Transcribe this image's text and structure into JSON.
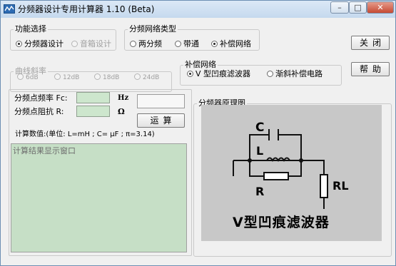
{
  "window": {
    "title": "分频器设计专用计算器 1.10 (Beta)",
    "controls": {
      "minimize": "–",
      "maximize": "□",
      "close": "✕"
    }
  },
  "function_group": {
    "legend": "功能选择",
    "options": [
      {
        "label": "分频器设计",
        "selected": true,
        "enabled": true
      },
      {
        "label": "音箱设计",
        "selected": false,
        "enabled": false
      }
    ]
  },
  "network_type_group": {
    "legend": "分频网络类型",
    "options": [
      {
        "label": "两分频",
        "selected": false
      },
      {
        "label": "带通",
        "selected": false
      },
      {
        "label": "补偿网络",
        "selected": true
      }
    ]
  },
  "slope_group": {
    "legend": "曲线斜率",
    "options": [
      {
        "label": "6dB"
      },
      {
        "label": "12dB"
      },
      {
        "label": "18dB"
      },
      {
        "label": "24dB"
      }
    ]
  },
  "compensation_group": {
    "legend": "补偿网络",
    "options": [
      {
        "label": "V 型凹痕滤波器",
        "selected": true
      },
      {
        "label": "渐斜补偿电路",
        "selected": false
      }
    ]
  },
  "buttons": {
    "close": "关闭",
    "help": "帮助",
    "compute": "运算"
  },
  "inputs": {
    "freq_label": "分频点频率 Fc:",
    "freq_value": "",
    "freq_unit": "Hz",
    "imp_label": "分频点阻抗 R:",
    "imp_value": "",
    "imp_unit": "Ω"
  },
  "calc_info": "计算数值:(单位: L=mH  ; C= μF  ; π=3.14)",
  "result_placeholder": "计算结果显示窗口",
  "diagram": {
    "legend": "分频器原理图",
    "labels": {
      "c": "C",
      "l": "L",
      "r": "R",
      "rl": "RL"
    },
    "caption": "V型凹痕滤波器"
  }
}
